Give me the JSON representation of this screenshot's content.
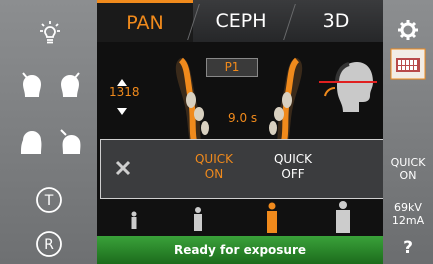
{
  "tabs": {
    "pan": "PAN",
    "ceph": "CEPH",
    "threed": "3D"
  },
  "program": {
    "label": "P1",
    "value": "1318",
    "time": "9.0 s"
  },
  "popup": {
    "on_line1": "QUICK",
    "on_line2": "ON",
    "off_line1": "QUICK",
    "off_line2": "OFF"
  },
  "right": {
    "quick_line1": "QUICK",
    "quick_line2": "ON",
    "kv": "69kV",
    "ma": "12mA",
    "help": "?"
  },
  "status": "Ready for exposure",
  "left": {
    "t_label": "T",
    "r_label": "R"
  },
  "colors": {
    "accent": "#f08a1c",
    "ready": "#2e8b2e"
  }
}
